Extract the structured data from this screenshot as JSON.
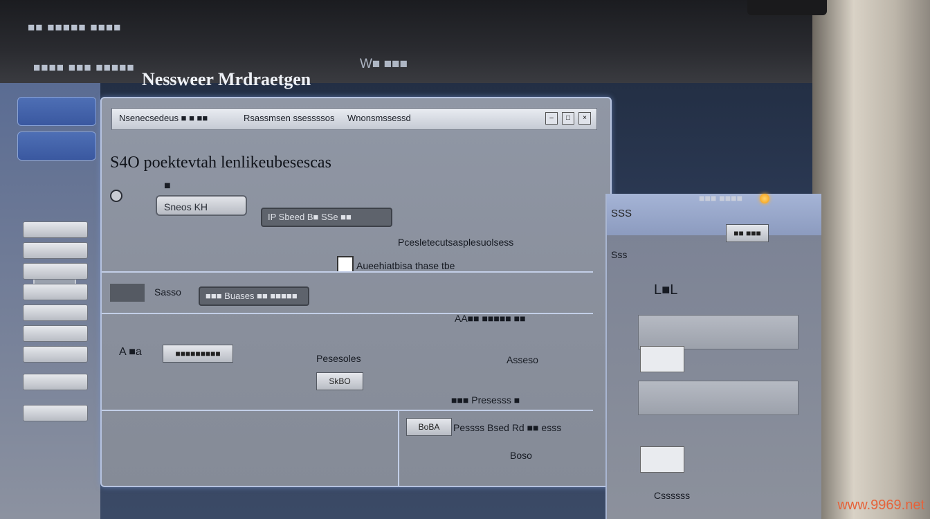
{
  "bezel": {
    "top_line_1": "■■ ■■■■■ ■■■■",
    "top_line_2": "■■■■ ■■■ ■■■■■",
    "watermark_top": "W■ ■■■"
  },
  "app": {
    "title": "Nessweer Mrdraetgen"
  },
  "sidebar": {
    "tabs": [
      "",
      ""
    ],
    "buttons": [
      "",
      "",
      "",
      "",
      "",
      "",
      "",
      "",
      ""
    ]
  },
  "dialog": {
    "titlebar_left": "Nsenecsedeus ■ ■ ■■",
    "titlebar_center": "Rsassmsen ssessssos",
    "titlebar_right": "Wnonsmssessd",
    "heading": "S4O poektevtah lenlikeubesescas",
    "subheading": "■",
    "field_1": "Sneos KH",
    "dark_field_1": "IP Sbeed B■ SSe ■■",
    "note_1": "Pcesletecutsasplesuolsess",
    "checkbox_label": "Aueehiatbisa thase tbe",
    "row2_label": "Sasso",
    "dark_field_2": "■■■ Buases ■■ ■■■■■",
    "row2_right": "AA■■ ■■■■■ ■■",
    "row3_label": "A ■a",
    "field_2": "■■■■■■■■■",
    "row3_mid": "Pesesoles",
    "row3_btn": "SkBO",
    "row3_right": "Asseso",
    "row4_right": "■■■ Presesss ■",
    "bottom_field": "BoBA",
    "bottom_text": "Pessss Bsed Rd ■■ esss",
    "bottom_right": "Boso"
  },
  "right_panel": {
    "header": "SSS",
    "header_btn": "■■ ■■■",
    "section": "Sss",
    "big_label": "L■L",
    "rows": [
      "",
      "",
      "",
      ""
    ],
    "footer": "Cssssss"
  },
  "status": {
    "indicator_color": "#f29a12",
    "label": "■■■ ■■■■"
  },
  "corner_watermark": "www.9969.net"
}
